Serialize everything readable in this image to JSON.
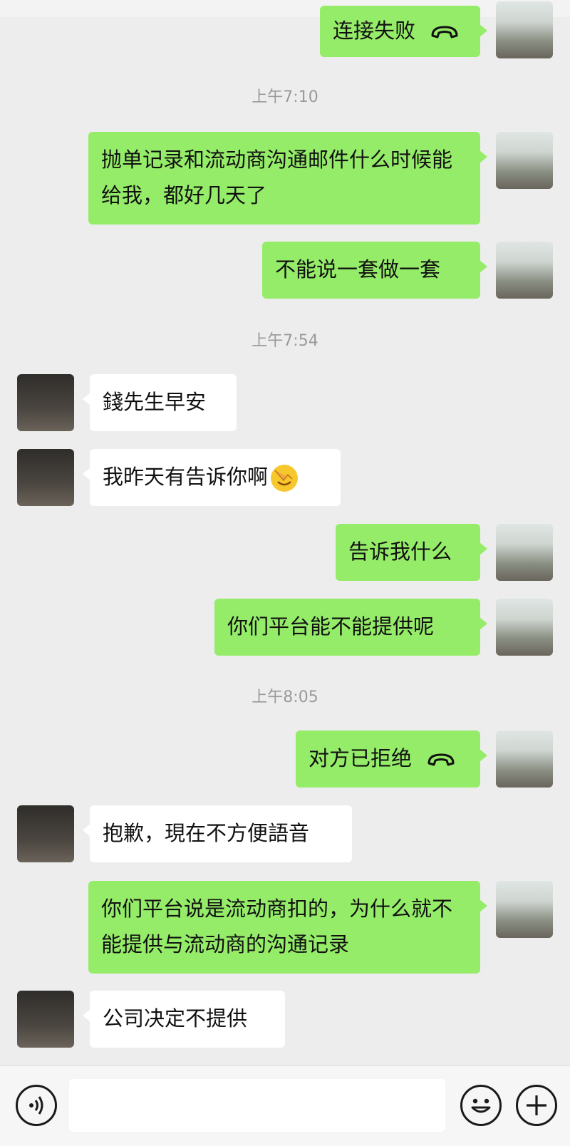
{
  "messages": {
    "m0": "连接失败",
    "t1": "上午7:10",
    "m1": "抛单记录和流动商沟通邮件什么时候能给我，都好几天了",
    "m2": "不能说一套做一套",
    "t2": "上午7:54",
    "m3": "錢先生早安",
    "m4": "我昨天有告诉你啊",
    "m5": "告诉我什么",
    "m6": "你们平台能不能提供呢",
    "t3": "上午8:05",
    "m7": "对方已拒绝",
    "m8": "抱歉，現在不方便語音",
    "m9": "你们平台说是流动商扣的，为什么就不能提供与流动商的沟通记录",
    "m10": "公司决定不提供"
  },
  "icons": {
    "call": "phone-hangup-icon",
    "facepalm": "facepalm-emoji-icon",
    "voice": "voice-input-icon",
    "emoji": "emoji-icon",
    "add": "plus-icon"
  },
  "colors": {
    "my_bubble": "#95ec69",
    "their_bubble": "#ffffff",
    "background": "#ededed"
  }
}
